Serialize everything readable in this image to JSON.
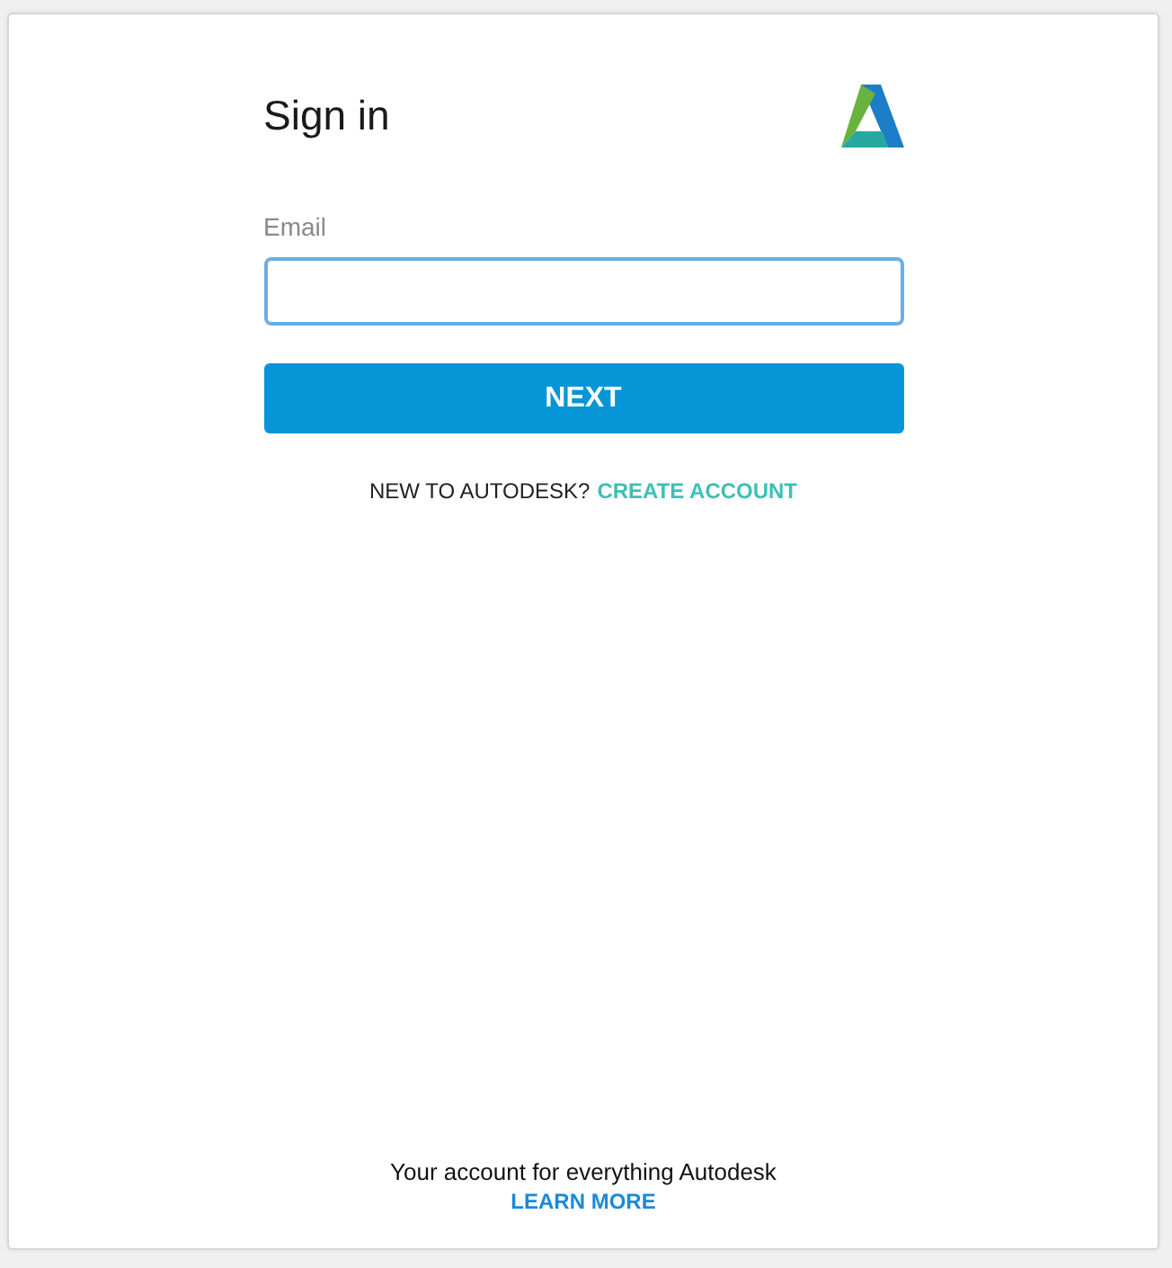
{
  "title": "Sign in",
  "email": {
    "label": "Email"
  },
  "next_button": "NEXT",
  "signup_prompt": {
    "text": "NEW TO AUTODESK?",
    "link": "CREATE ACCOUNT"
  },
  "footer": {
    "text": "Your account for everything Autodesk",
    "link": "LEARN MORE"
  }
}
